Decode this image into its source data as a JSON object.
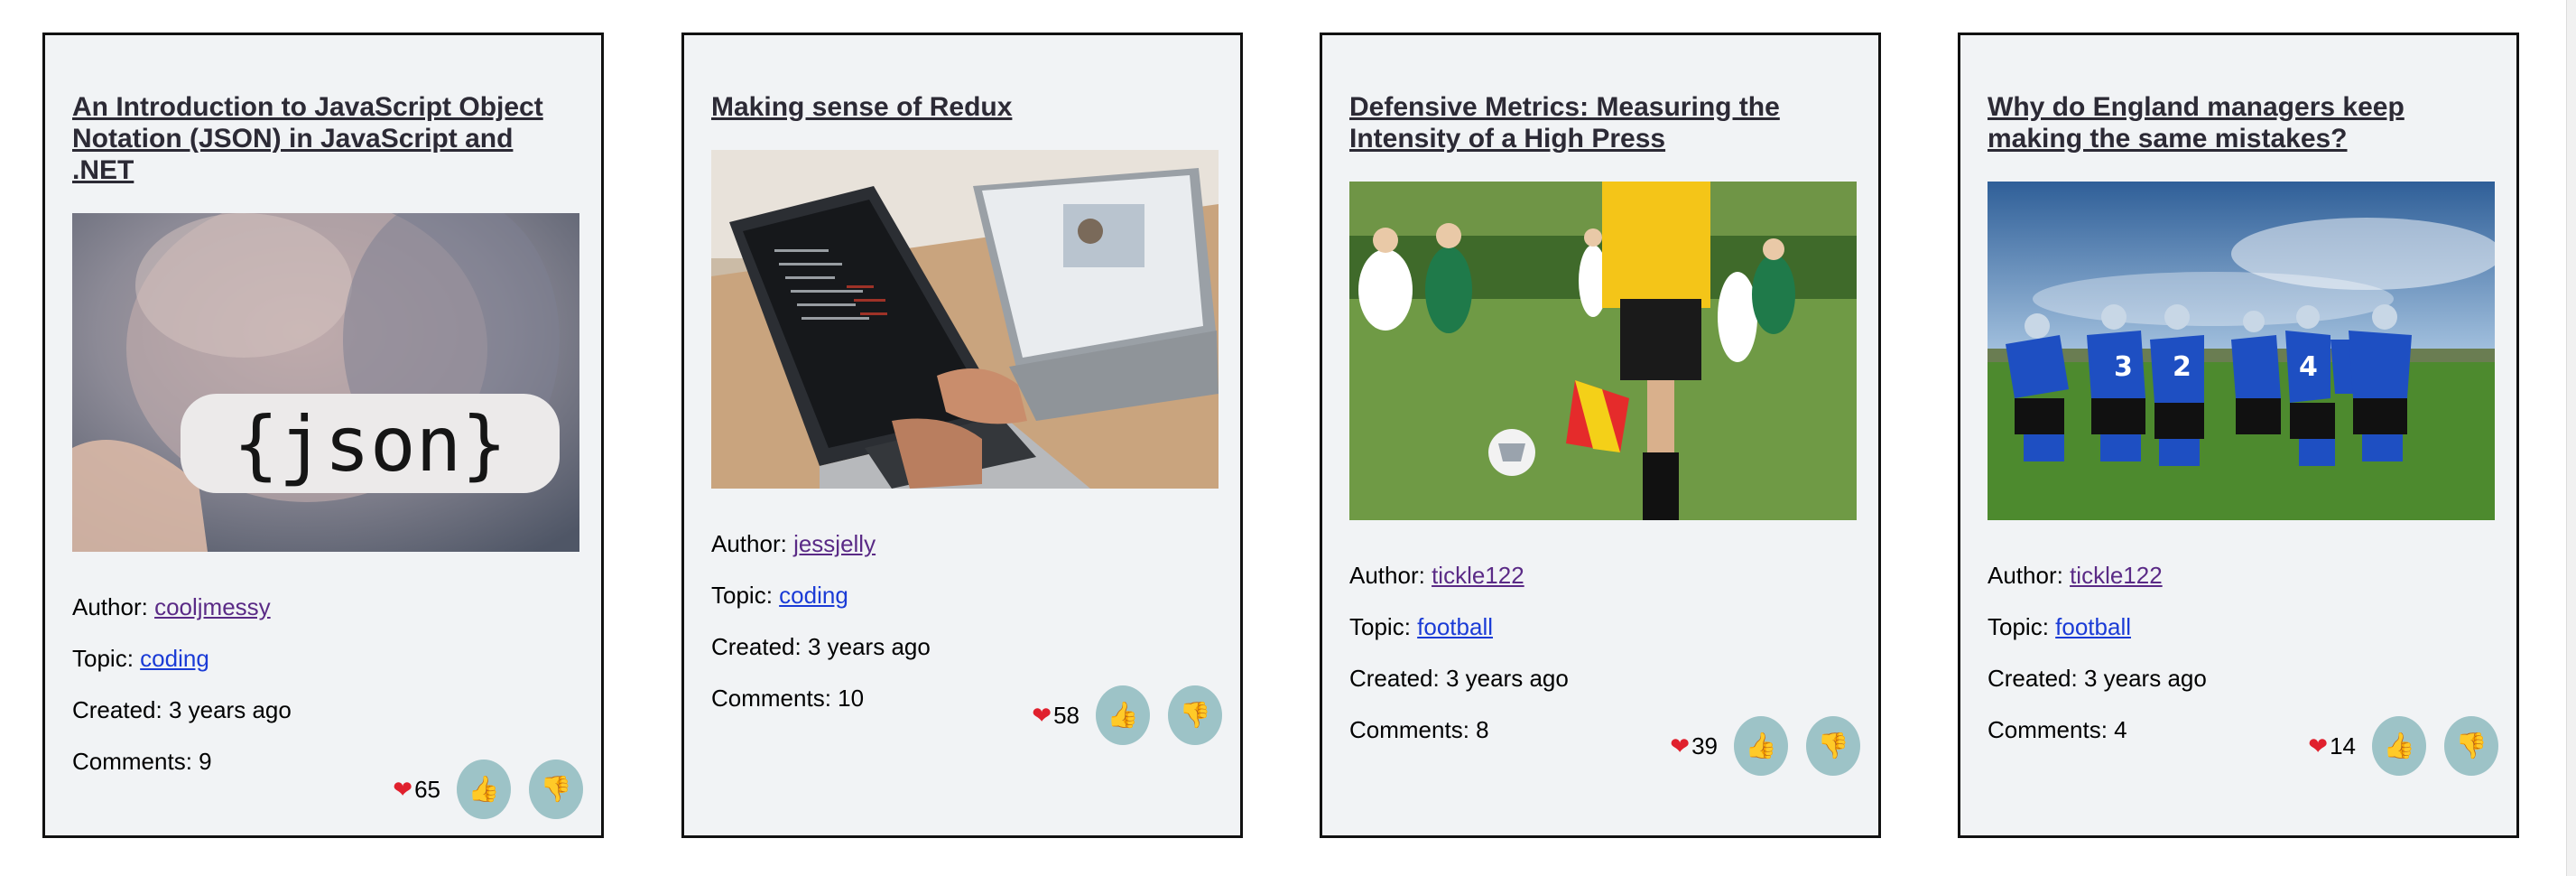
{
  "labels": {
    "author": "Author: ",
    "topic": "Topic: ",
    "created": "Created: ",
    "comments": "Comments: "
  },
  "articles": [
    {
      "title": "An Introduction to JavaScript Object Notation (JSON) in JavaScript and .NET",
      "image_alt": "{json}",
      "author": "cooljmessy",
      "topic": "coding",
      "created": "3 years ago",
      "comments": "9",
      "likes": "65",
      "up_icon": "thumbs-up-icon",
      "down_icon": "thumbs-down-icon"
    },
    {
      "title": "Making sense of Redux",
      "image_alt": "",
      "author": "jessjelly",
      "topic": "coding",
      "created": "3 years ago",
      "comments": "10",
      "likes": "58",
      "up_icon": "thumbs-up-icon",
      "down_icon": "thumbs-down-icon"
    },
    {
      "title": "Defensive Metrics: Measuring the Intensity of a High Press",
      "image_alt": "",
      "author": "tickle122",
      "topic": "football",
      "created": "3 years ago",
      "comments": "8",
      "likes": "39",
      "up_icon": "thumbs-up-icon",
      "down_icon": "thumbs-down-icon"
    },
    {
      "title": "Why do England managers keep making the same mistakes?",
      "image_alt": "",
      "author": "tickle122",
      "topic": "football",
      "created": "3 years ago",
      "comments": "4",
      "likes": "14",
      "up_icon": "thumbs-up-icon",
      "down_icon": "thumbs-down-icon"
    }
  ],
  "colors": {
    "card_bg": "#f1f3f5",
    "title": "#2c2a35",
    "visited_link": "#5a2a86",
    "topic_link": "#1a3bd6",
    "vote_button": "#9dc3c7",
    "heart": "#e0202d"
  }
}
